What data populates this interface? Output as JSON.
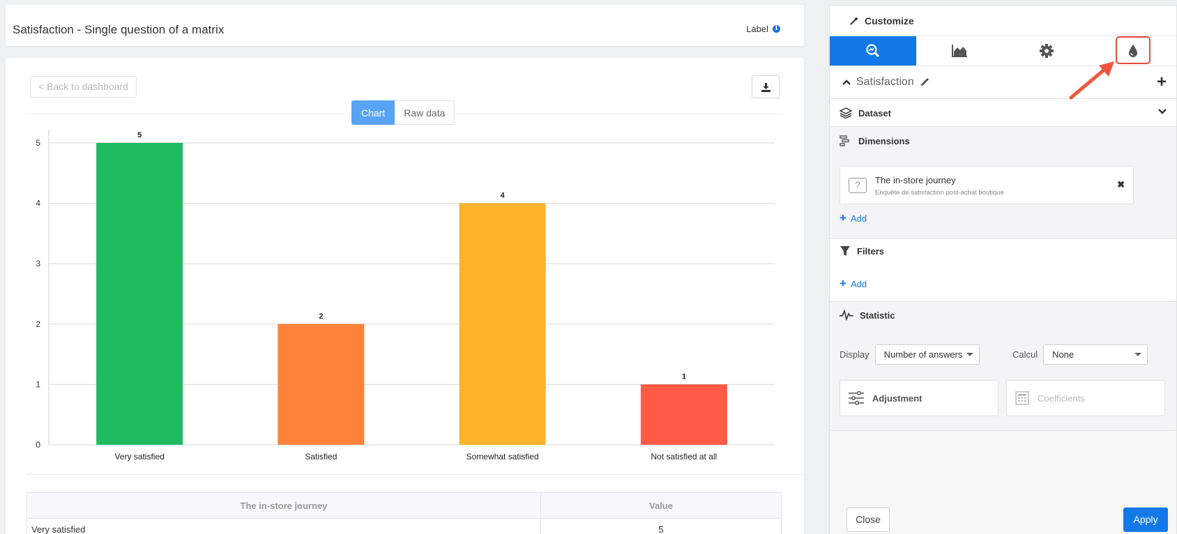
{
  "header": {
    "title": "Satisfaction - Single question of a matrix",
    "label_text": "Label"
  },
  "main": {
    "back_button": "< Back to dashboard",
    "tabs": [
      {
        "label": "Chart",
        "active": true
      },
      {
        "label": "Raw data",
        "active": false
      }
    ]
  },
  "chart_data": {
    "type": "bar",
    "categories": [
      "Very satisfied",
      "Satisfied",
      "Somewhat satisfied",
      "Not satisfied at all"
    ],
    "values": [
      5,
      2,
      4,
      1
    ],
    "colors": [
      "#1ebb60",
      "#ff823b",
      "#fdb22e",
      "#ff5a45"
    ],
    "ylim": [
      0,
      5
    ],
    "yticks": [
      0,
      1,
      2,
      3,
      4,
      5
    ],
    "grid": true,
    "title": "",
    "xlabel": "",
    "ylabel": ""
  },
  "table": {
    "headers": [
      "The in-store journey",
      "Value"
    ],
    "rows": [
      [
        "Very satisfied",
        "5"
      ]
    ]
  },
  "panel": {
    "title": "Customize",
    "tool_tabs": [
      "search-chart-icon",
      "area-chart-icon",
      "gear-icon",
      "drop-icon"
    ],
    "chart_name": "Satisfaction",
    "sections": {
      "dataset": "Dataset",
      "dimensions": "Dimensions",
      "filters": "Filters",
      "statistic": "Statistic"
    },
    "dimension": {
      "name": "The in-store journey",
      "subtitle": "Enquête de satisfaction post-achat boutique"
    },
    "add_label": "Add",
    "display_label": "Display",
    "display_value": "Number of answers",
    "calcul_label": "Calcul",
    "calcul_value": "None",
    "adjustment": "Adjustment",
    "coefficients": "Coefficients",
    "close": "Close",
    "apply": "Apply"
  }
}
